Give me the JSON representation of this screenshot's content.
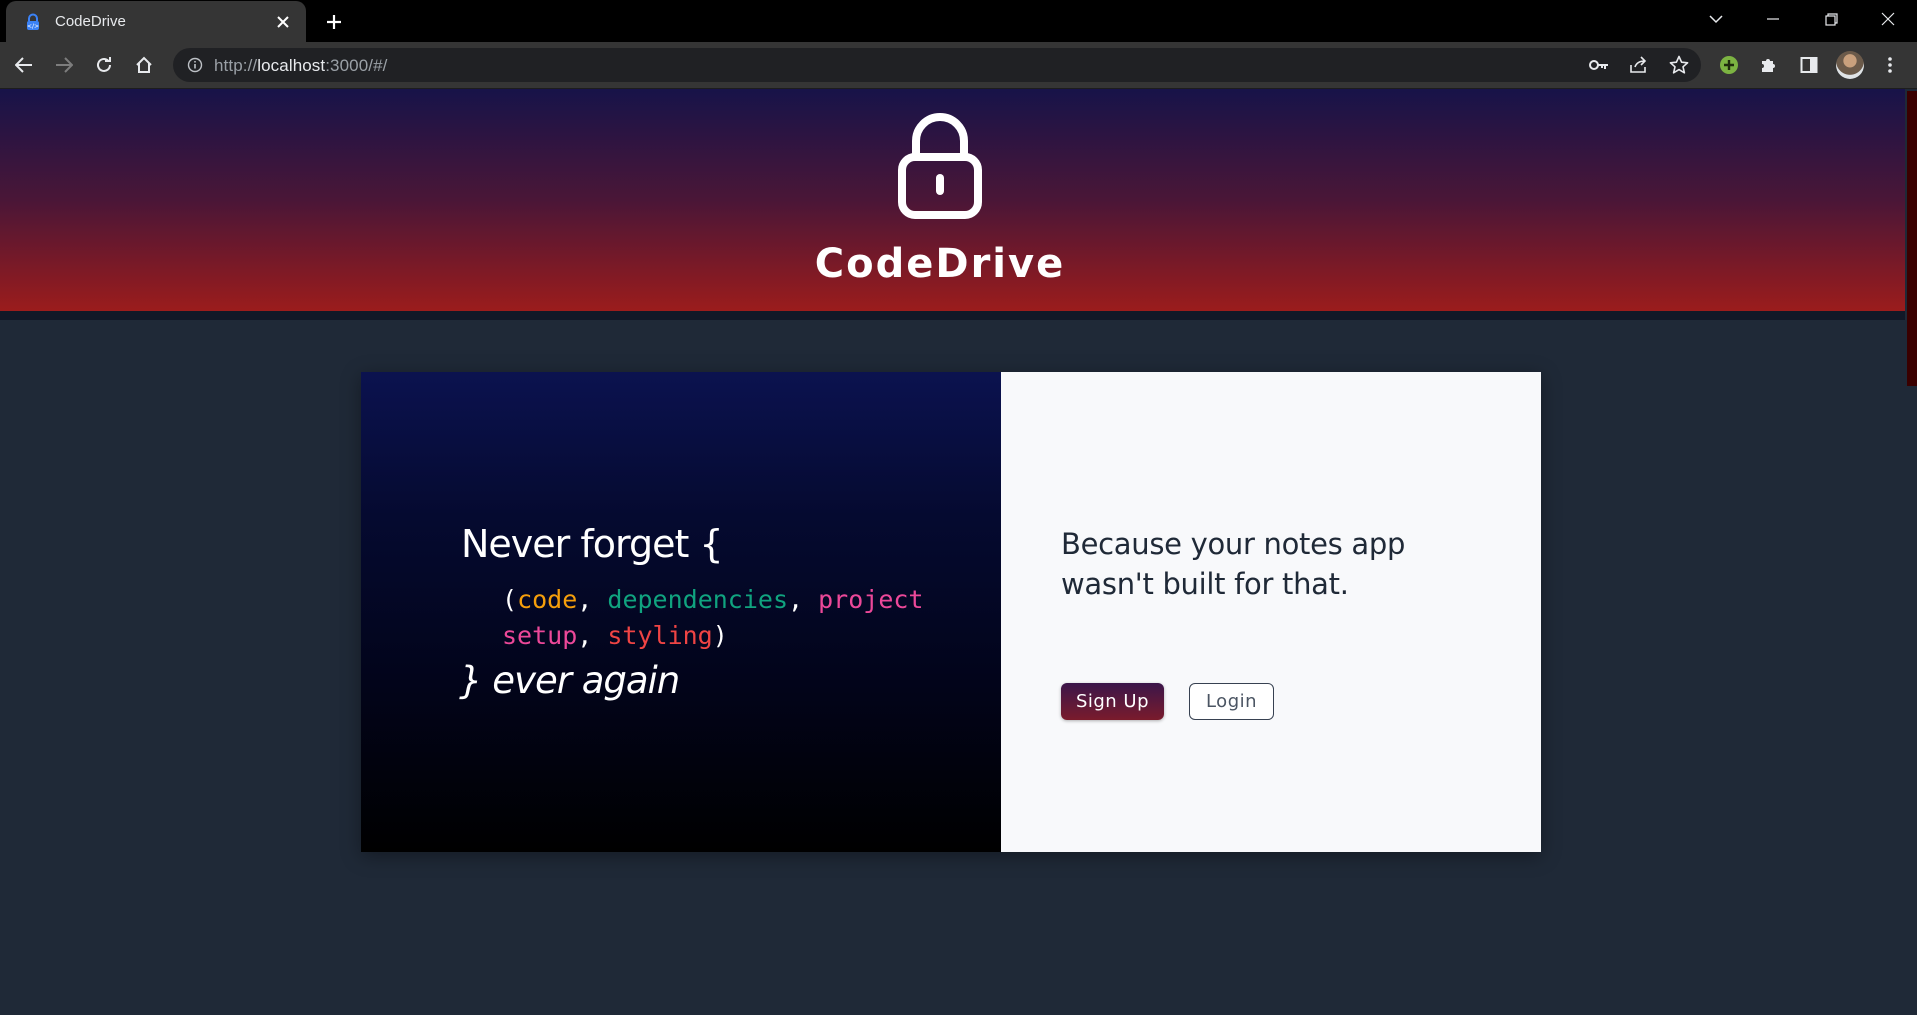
{
  "browser": {
    "tab": {
      "title": "CodeDrive"
    },
    "url": {
      "prefix": "http://",
      "host": "localhost",
      "rest": ":3000/#/"
    }
  },
  "header": {
    "brand": "CodeDrive"
  },
  "hero": {
    "never_forget": "Never forget {",
    "open_paren": "(",
    "items": [
      {
        "text": "code",
        "color": "#f59e0b"
      },
      {
        "text": "dependencies",
        "color": "#10a37f"
      },
      {
        "text": "project setup",
        "color": "#ec4899"
      },
      {
        "text": "styling",
        "color": "#ef4444"
      }
    ],
    "close_paren": ")",
    "ever_again": "} ever again"
  },
  "cta": {
    "tagline": "Because your notes app wasn't built for that.",
    "signup_label": "Sign Up",
    "login_label": "Login"
  },
  "colors": {
    "header_gradient_top": "#171349",
    "header_gradient_bottom": "#9b1c1c",
    "page_background": "#1f2937"
  }
}
